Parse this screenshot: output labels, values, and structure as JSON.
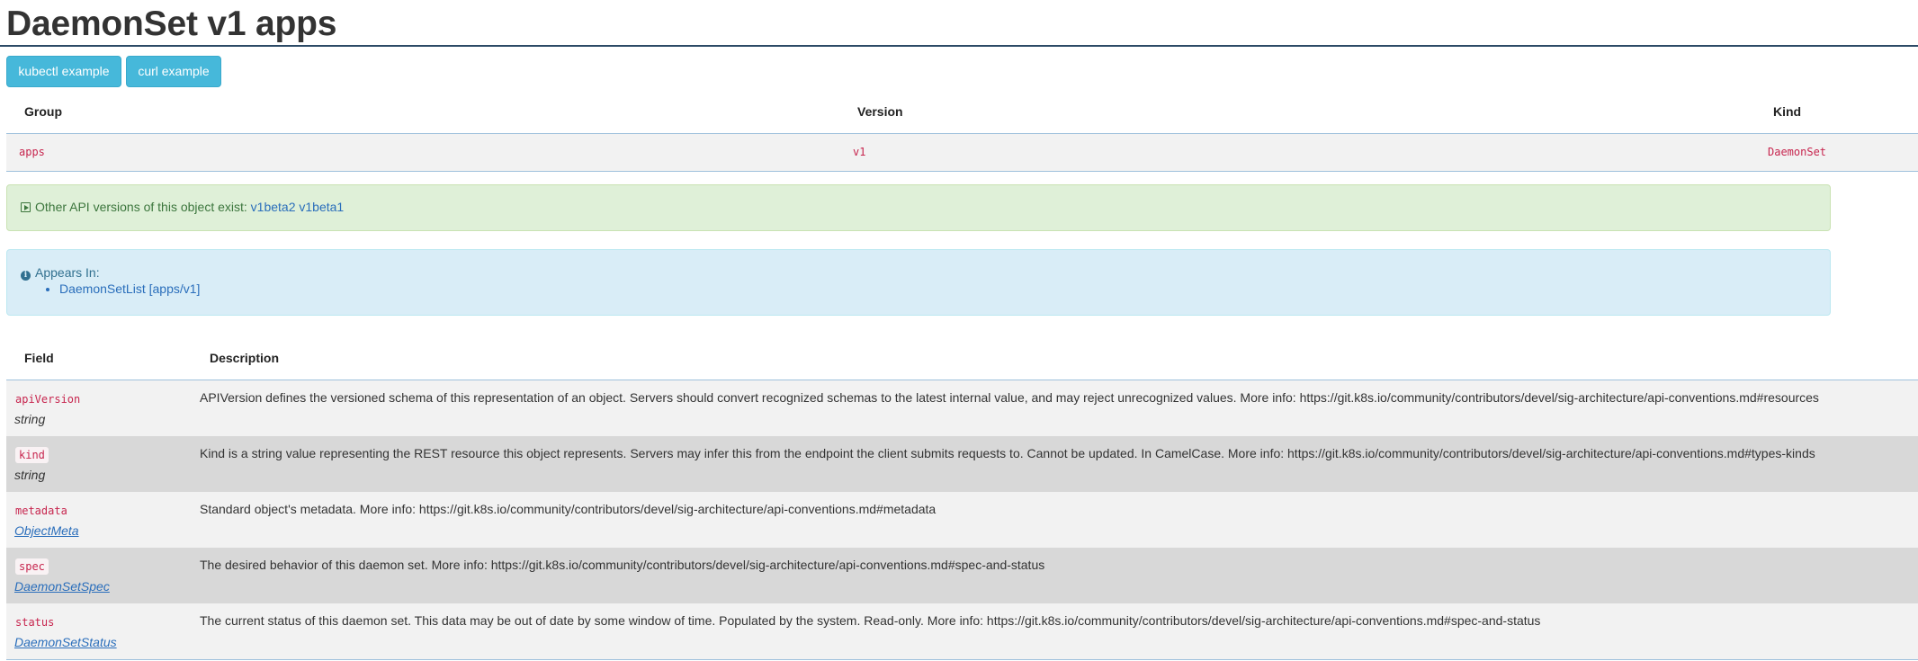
{
  "title": "DaemonSet v1 apps",
  "buttons": {
    "kubectl": "kubectl example",
    "curl": "curl example"
  },
  "gvk": {
    "headers": {
      "group": "Group",
      "version": "Version",
      "kind": "Kind"
    },
    "row": {
      "group": "apps",
      "version": "v1",
      "kind": "DaemonSet"
    }
  },
  "other_versions": {
    "text": "Other API versions of this object exist:",
    "links": [
      "v1beta2",
      "v1beta1"
    ]
  },
  "appears_in": {
    "heading": "Appears In:",
    "items": [
      "DaemonSetList [apps/v1]"
    ]
  },
  "fields": {
    "headers": {
      "field": "Field",
      "description": "Description"
    },
    "rows": [
      {
        "name": "apiVersion",
        "type": "string",
        "description": "APIVersion defines the versioned schema of this representation of an object. Servers should convert recognized schemas to the latest internal value, and may reject unrecognized values. More info: https://git.k8s.io/community/contributors/devel/sig-architecture/api-conventions.md#resources"
      },
      {
        "name": "kind",
        "type": "string",
        "description": "Kind is a string value representing the REST resource this object represents. Servers may infer this from the endpoint the client submits requests to. Cannot be updated. In CamelCase. More info: https://git.k8s.io/community/contributors/devel/sig-architecture/api-conventions.md#types-kinds"
      },
      {
        "name": "metadata",
        "type": "ObjectMeta",
        "description": "Standard object's metadata. More info: https://git.k8s.io/community/contributors/devel/sig-architecture/api-conventions.md#metadata"
      },
      {
        "name": "spec",
        "type": "DaemonSetSpec",
        "description": "The desired behavior of this daemon set. More info: https://git.k8s.io/community/contributors/devel/sig-architecture/api-conventions.md#spec-and-status"
      },
      {
        "name": "status",
        "type": "DaemonSetStatus",
        "description": "The current status of this daemon set. This data may be out of date by some window of time. Populated by the system. Read-only. More info: https://git.k8s.io/community/contributors/devel/sig-architecture/api-conventions.md#spec-and-status"
      }
    ]
  }
}
